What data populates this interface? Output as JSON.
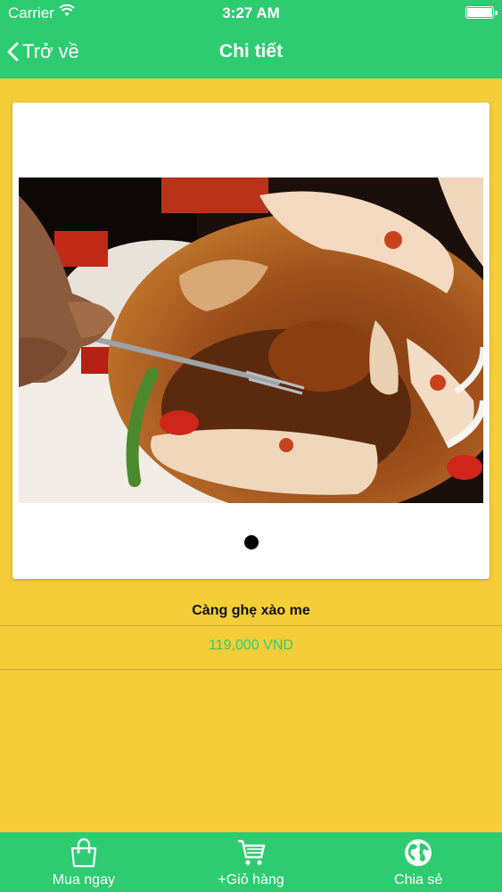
{
  "status_bar": {
    "carrier": "Carrier",
    "time": "3:27 AM",
    "battery_level": 1.0
  },
  "nav": {
    "back_label": "Trở về",
    "title": "Chi tiết"
  },
  "gallery": {
    "image_alt": "Càng ghẹ xào me",
    "page_count": 1,
    "current_page": 1
  },
  "product": {
    "name": "Càng ghẹ xào me",
    "price": "119,000 VND"
  },
  "tabs": [
    {
      "label": "Mua ngay",
      "icon": "shopping-bag-icon"
    },
    {
      "label": "+Giỏ hàng",
      "icon": "cart-icon"
    },
    {
      "label": "Chia sẻ",
      "icon": "globe-icon"
    }
  ],
  "colors": {
    "accent": "#2ecc71",
    "background": "#f5cd38",
    "price": "#2ecc71"
  }
}
